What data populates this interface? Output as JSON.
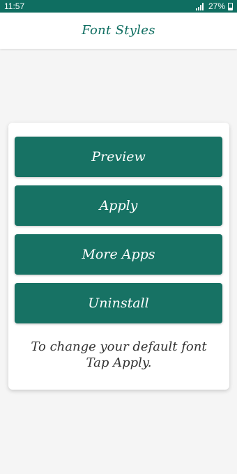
{
  "status_bar": {
    "time": "11:57",
    "battery": "27%",
    "icons": [
      "wifi-calling-icon",
      "signal-icon",
      "battery-icon"
    ]
  },
  "app_bar": {
    "title": "Font Styles"
  },
  "buttons": {
    "preview": "Preview",
    "apply": "Apply",
    "more_apps": "More Apps",
    "uninstall": "Uninstall"
  },
  "hint": {
    "line1": "To change your default font",
    "line2": "Tap Apply."
  },
  "colors": {
    "primary": "#0f6e61",
    "button": "#177264",
    "background": "#f5f5f5"
  }
}
